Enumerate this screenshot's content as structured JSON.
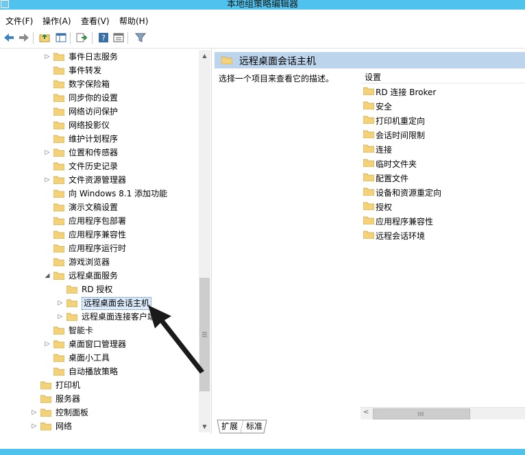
{
  "window": {
    "title": "本地组策略编辑器"
  },
  "menu": [
    "文件(F)",
    "操作(A)",
    "查看(V)",
    "帮助(H)"
  ],
  "toolbar": [
    "back-icon",
    "forward-icon",
    "up-folder-icon",
    "show-hide-tree-icon",
    "export-list-icon",
    "help-icon",
    "properties-icon",
    "filter-icon"
  ],
  "tree": [
    {
      "label": "事件日志服务",
      "expander": "▷"
    },
    {
      "label": "事件转发",
      "expander": ""
    },
    {
      "label": "数字保险箱",
      "expander": ""
    },
    {
      "label": "同步你的设置",
      "expander": ""
    },
    {
      "label": "网络访问保护",
      "expander": ""
    },
    {
      "label": "网络投影仪",
      "expander": ""
    },
    {
      "label": "维护计划程序",
      "expander": ""
    },
    {
      "label": "位置和传感器",
      "expander": "▷"
    },
    {
      "label": "文件历史记录",
      "expander": ""
    },
    {
      "label": "文件资源管理器",
      "expander": "▷"
    },
    {
      "label": "向 Windows 8.1 添加功能",
      "expander": ""
    },
    {
      "label": "演示文稿设置",
      "expander": ""
    },
    {
      "label": "应用程序包部署",
      "expander": ""
    },
    {
      "label": "应用程序兼容性",
      "expander": ""
    },
    {
      "label": "应用程序运行时",
      "expander": ""
    },
    {
      "label": "游戏浏览器",
      "expander": ""
    },
    {
      "label": "远程桌面服务",
      "expander": "◢"
    },
    {
      "label": "RD 授权",
      "expander": ""
    },
    {
      "label": "远程桌面会话主机",
      "expander": "▷"
    },
    {
      "label": "远程桌面连接客户端",
      "expander": "▷"
    },
    {
      "label": "智能卡",
      "expander": ""
    },
    {
      "label": "桌面窗口管理器",
      "expander": "▷"
    },
    {
      "label": "桌面小工具",
      "expander": ""
    },
    {
      "label": "自动播放策略",
      "expander": ""
    },
    {
      "label": "打印机",
      "expander": ""
    },
    {
      "label": "服务器",
      "expander": ""
    },
    {
      "label": "控制面板",
      "expander": "▷"
    },
    {
      "label": "网络",
      "expander": "▷"
    }
  ],
  "right": {
    "header_title": "远程桌面会话主机",
    "description": "选择一个项目来查看它的描述。",
    "column_header": "设置",
    "items": [
      "RD 连接 Broker",
      "安全",
      "打印机重定向",
      "会话时间限制",
      "连接",
      "临时文件夹",
      "配置文件",
      "设备和资源重定向",
      "授权",
      "应用程序兼容性",
      "远程会话环境"
    ]
  },
  "tabs": [
    "扩展",
    "标准"
  ],
  "colors": {
    "titlebar": "#4fc3ee",
    "header": "#bcd5ec",
    "folder": "#f4d27a"
  }
}
